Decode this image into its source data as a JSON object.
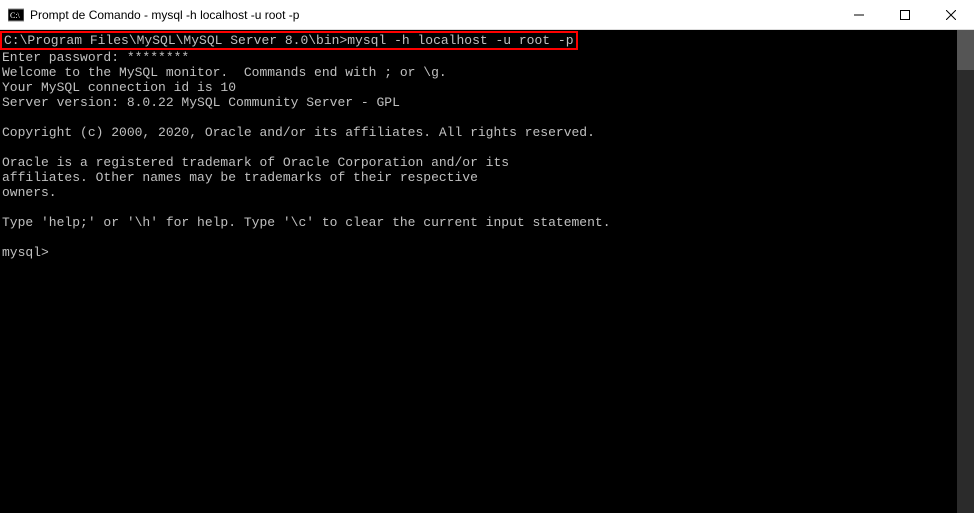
{
  "titlebar": {
    "title": "Prompt de Comando - mysql  -h localhost -u root -p",
    "minimize": "—",
    "maximize": "▢",
    "close": "✕"
  },
  "terminal": {
    "highlighted_command": "C:\\Program Files\\MySQL\\MySQL Server 8.0\\bin>mysql -h localhost -u root -p",
    "lines": [
      "Enter password: ********",
      "Welcome to the MySQL monitor.  Commands end with ; or \\g.",
      "Your MySQL connection id is 10",
      "Server version: 8.0.22 MySQL Community Server - GPL",
      "",
      "Copyright (c) 2000, 2020, Oracle and/or its affiliates. All rights reserved.",
      "",
      "Oracle is a registered trademark of Oracle Corporation and/or its",
      "affiliates. Other names may be trademarks of their respective",
      "owners.",
      "",
      "Type 'help;' or '\\h' for help. Type '\\c' to clear the current input statement.",
      ""
    ],
    "prompt": "mysql>"
  }
}
